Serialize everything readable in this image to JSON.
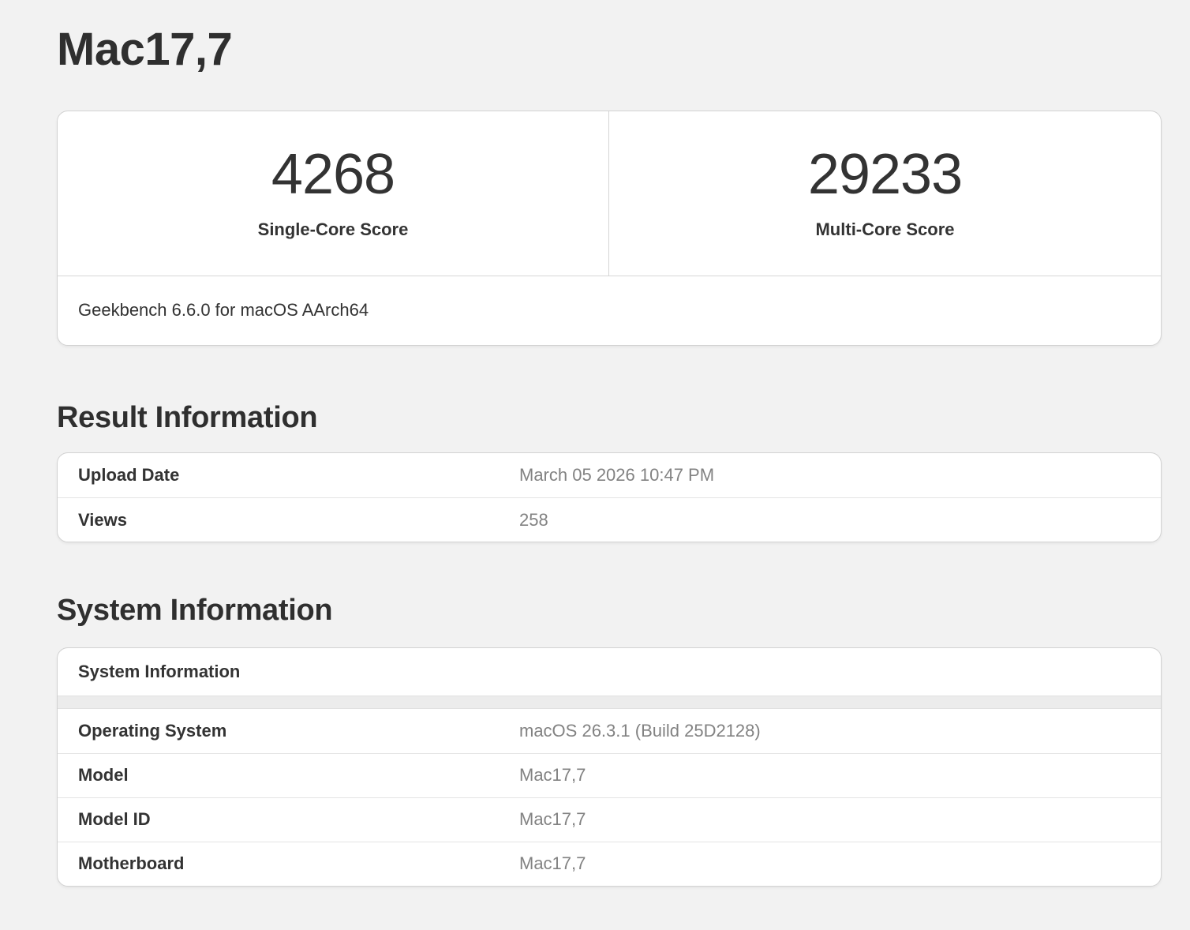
{
  "page": {
    "title": "Mac17,7",
    "background_color": "#f2f2f2",
    "heading_color": "#2f2f2f",
    "label_color": "#333333",
    "value_color": "#828282"
  },
  "scores": {
    "single_core": {
      "value": "4268",
      "label": "Single-Core Score"
    },
    "multi_core": {
      "value": "29233",
      "label": "Multi-Core Score"
    },
    "benchmark_version": "Geekbench 6.6.0 for macOS AArch64"
  },
  "result_information": {
    "heading": "Result Information",
    "rows": [
      {
        "label": "Upload Date",
        "value": "March 05 2026 10:47 PM"
      },
      {
        "label": "Views",
        "value": "258"
      }
    ]
  },
  "system_information": {
    "heading": "System Information",
    "table_header": "System Information",
    "rows": [
      {
        "label": "Operating System",
        "value": "macOS 26.3.1 (Build 25D2128)"
      },
      {
        "label": "Model",
        "value": "Mac17,7"
      },
      {
        "label": "Model ID",
        "value": "Mac17,7"
      },
      {
        "label": "Motherboard",
        "value": "Mac17,7"
      }
    ]
  }
}
